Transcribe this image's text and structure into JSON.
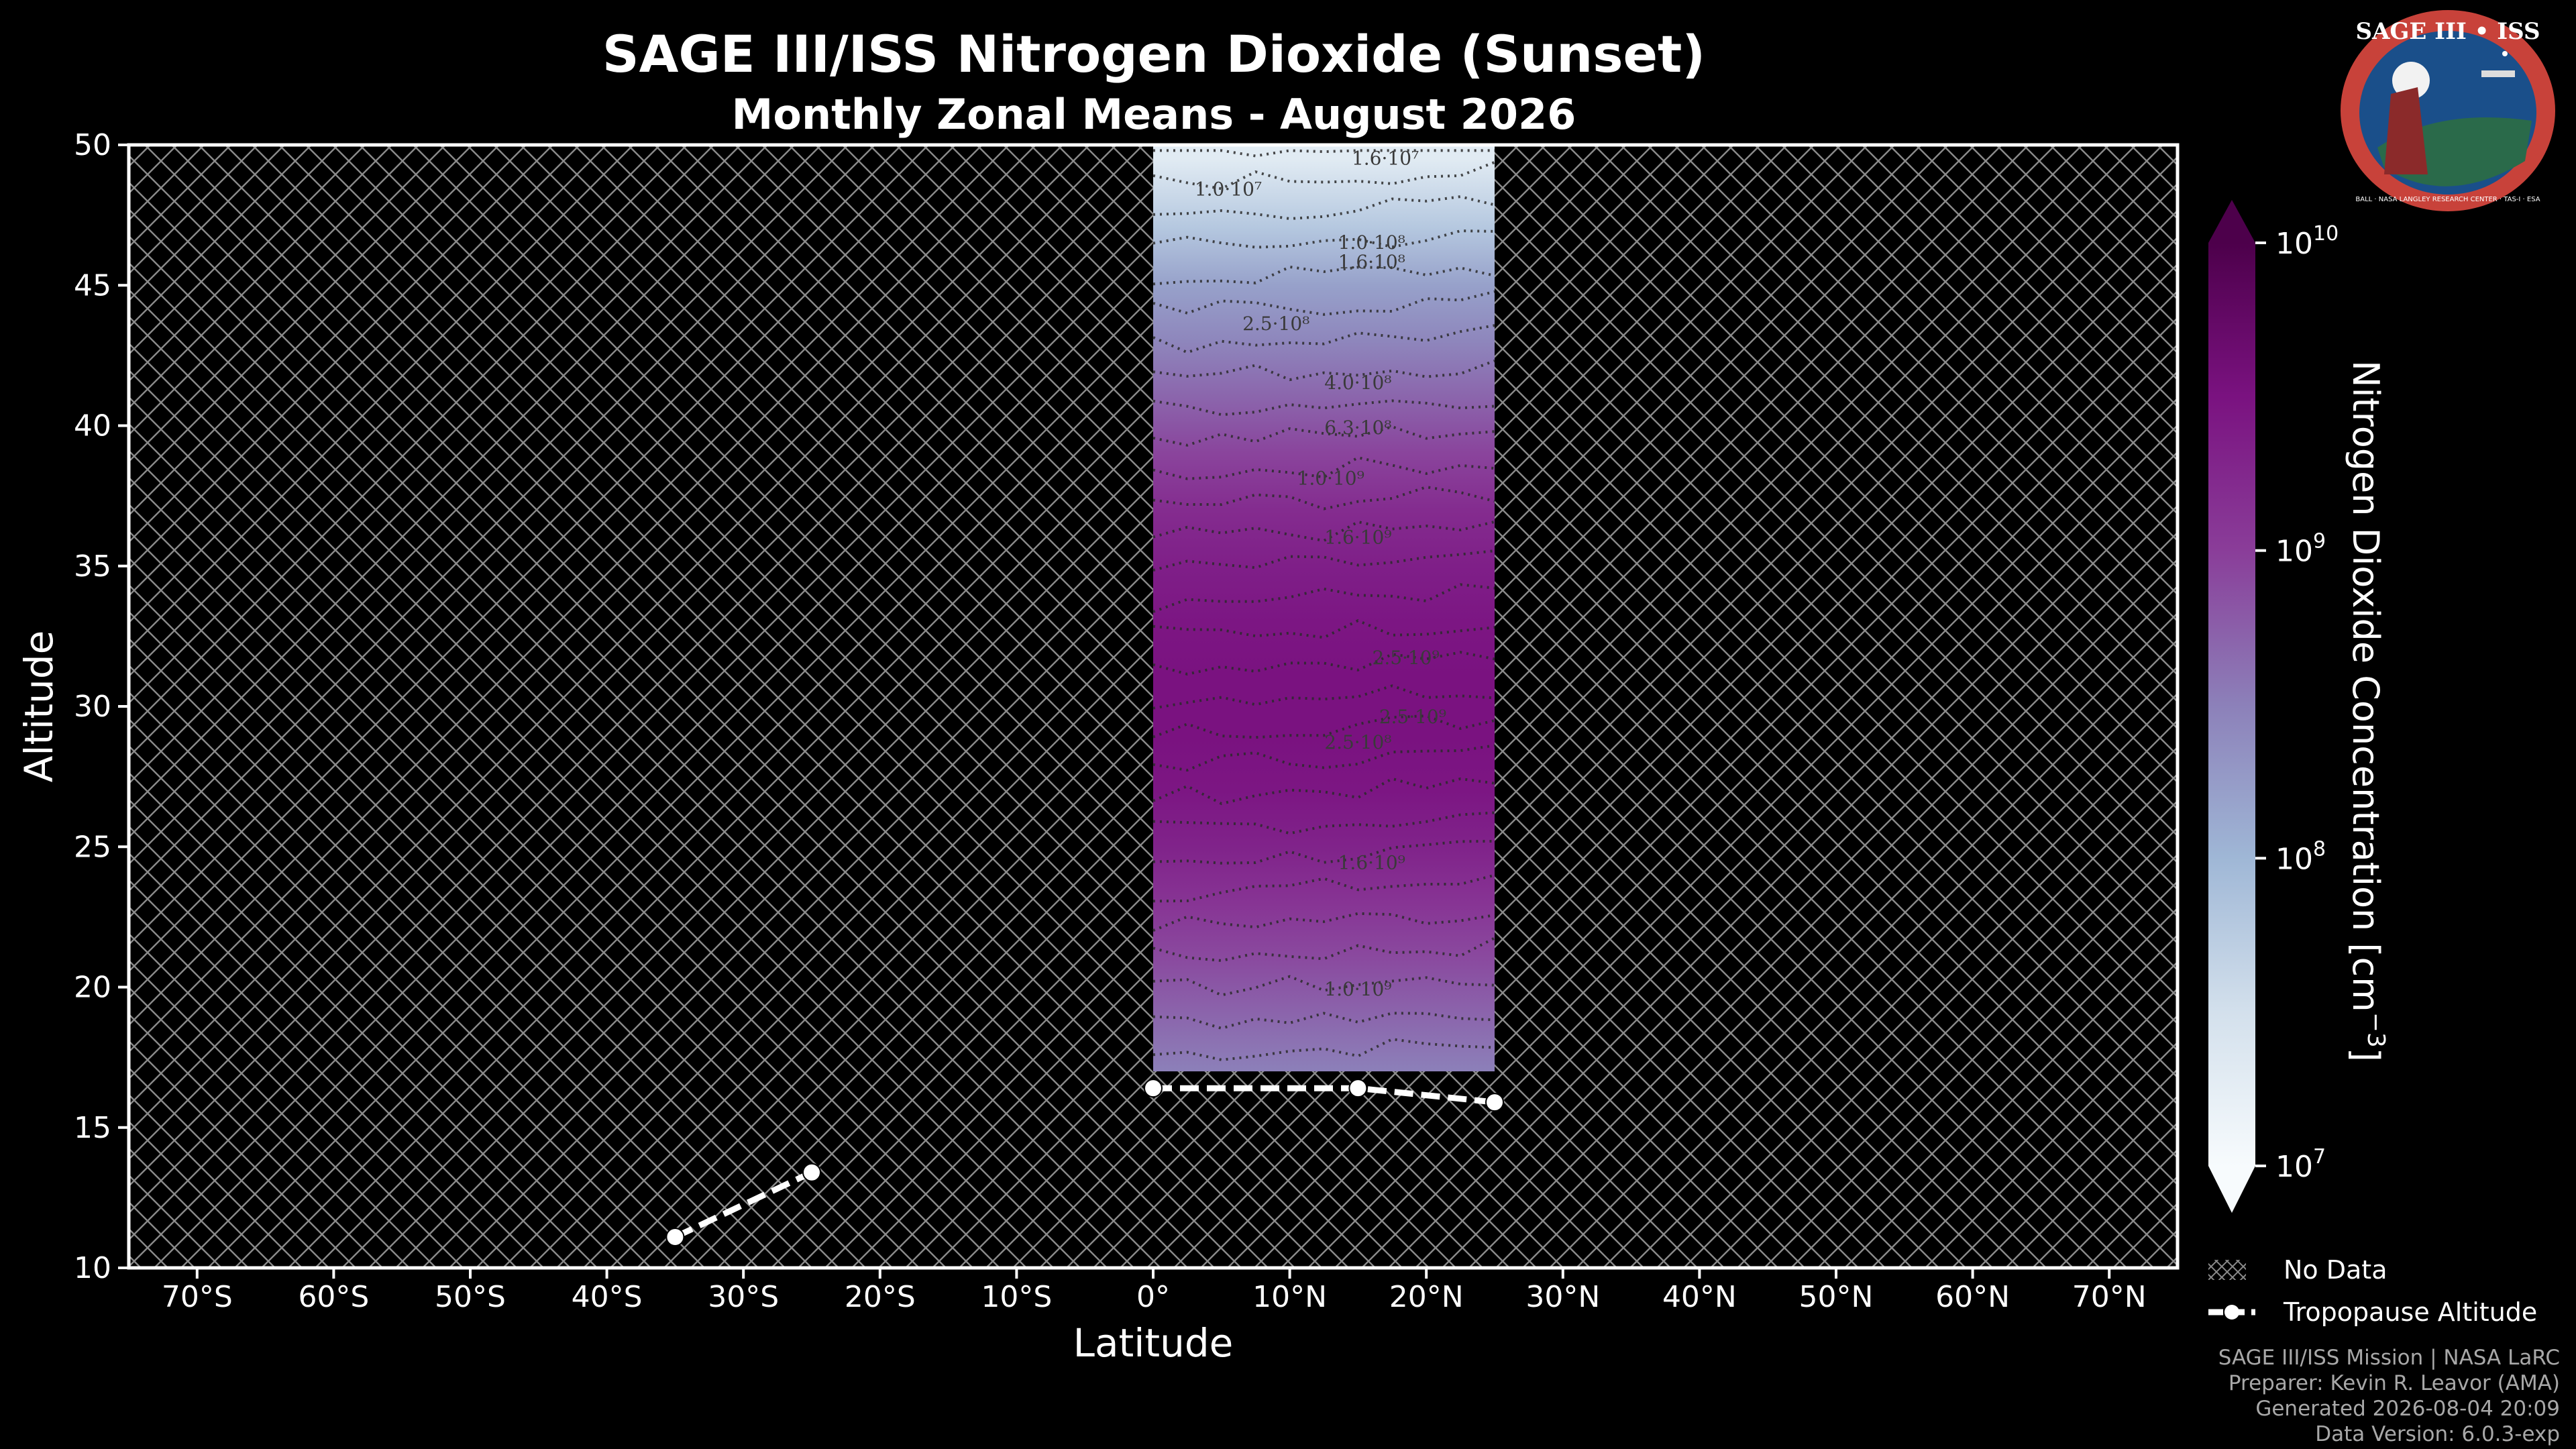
{
  "chart_data": {
    "type": "heatmap",
    "title": "SAGE III/ISS Nitrogen Dioxide (Sunset)",
    "subtitle": "Monthly Zonal Means - August 2026",
    "xlabel": "Latitude",
    "ylabel": "Altitude",
    "xlim": [
      -75,
      75
    ],
    "ylim": [
      10,
      50
    ],
    "x_ticks": [
      -70,
      -60,
      -50,
      -40,
      -30,
      -20,
      -10,
      0,
      10,
      20,
      30,
      40,
      50,
      60,
      70
    ],
    "x_tick_labels": [
      "70°S",
      "60°S",
      "50°S",
      "40°S",
      "30°S",
      "20°S",
      "10°S",
      "0°",
      "10°N",
      "20°N",
      "30°N",
      "40°N",
      "50°N",
      "60°N",
      "70°N"
    ],
    "y_ticks": [
      10,
      15,
      20,
      25,
      30,
      35,
      40,
      45,
      50
    ],
    "y_tick_labels": [
      "10",
      "15",
      "20",
      "25",
      "30",
      "35",
      "40",
      "45",
      "50"
    ],
    "data_region": {
      "lat_range": [
        0,
        25
      ],
      "alt_range": [
        17,
        50
      ]
    },
    "concentration_profile": {
      "altitude": [
        17,
        19,
        21,
        23,
        25,
        27,
        29,
        31,
        33,
        35,
        37,
        39,
        41,
        43,
        45,
        47,
        49.5
      ],
      "log10_value": [
        8.5,
        8.7,
        8.9,
        9.1,
        9.3,
        9.45,
        9.5,
        9.5,
        9.45,
        9.35,
        9.2,
        8.95,
        8.7,
        8.45,
        8.2,
        7.8,
        7.3
      ]
    },
    "colorbar": {
      "label": "Nitrogen Dioxide Concentration [cm",
      "label_sup": "−3",
      "label_end": "]",
      "scale": "log",
      "range": [
        10000000,
        10000000000
      ],
      "ticks": [
        {
          "value": 7,
          "base": "10",
          "exp": "7"
        },
        {
          "value": 8,
          "base": "10",
          "exp": "8"
        },
        {
          "value": 9,
          "base": "10",
          "exp": "9"
        },
        {
          "value": 10,
          "base": "10",
          "exp": "10"
        }
      ],
      "colors": [
        "#f7fbfd",
        "#d3e0ec",
        "#9fb7d6",
        "#8c80b9",
        "#8a3d99",
        "#7a1280",
        "#4d004b"
      ]
    },
    "contour_labels": [
      {
        "lat": 5.5,
        "alt": 48.2,
        "text": "1.0·10⁷"
      },
      {
        "lat": 17,
        "alt": 49.3,
        "text": "1.6·10⁷"
      },
      {
        "lat": 16,
        "alt": 46.3,
        "text": "1.0·10⁸"
      },
      {
        "lat": 16,
        "alt": 45.6,
        "text": "1.6·10⁸"
      },
      {
        "lat": 9,
        "alt": 43.4,
        "text": "2.5·10⁸"
      },
      {
        "lat": 15,
        "alt": 41.3,
        "text": "4.0·10⁸"
      },
      {
        "lat": 15,
        "alt": 39.7,
        "text": "6.3·10⁸"
      },
      {
        "lat": 13,
        "alt": 37.9,
        "text": "1.0·10⁹"
      },
      {
        "lat": 15,
        "alt": 35.8,
        "text": "1.6·10⁹"
      },
      {
        "lat": 18.5,
        "alt": 31.5,
        "text": "2.5·10⁹"
      },
      {
        "lat": 19,
        "alt": 29.4,
        "text": "2.5·10⁹"
      },
      {
        "lat": 15,
        "alt": 28.5,
        "text": "2.5·10⁸"
      },
      {
        "lat": 16,
        "alt": 24.2,
        "text": "1.6·10⁹"
      },
      {
        "lat": 15,
        "alt": 19.7,
        "text": "1.0·10⁹"
      }
    ],
    "series": [
      {
        "name": "Tropopause Altitude",
        "segments": [
          {
            "x": [
              -35,
              -25
            ],
            "y": [
              11.1,
              13.4
            ]
          },
          {
            "x": [
              0,
              15,
              25
            ],
            "y": [
              16.4,
              16.4,
              15.9
            ]
          }
        ]
      }
    ],
    "legend": {
      "position": "bottom-right",
      "entries": [
        {
          "label": "No Data",
          "kind": "hatch"
        },
        {
          "label": "Tropopause Altitude",
          "kind": "line"
        }
      ]
    },
    "grid": false,
    "no_data_pattern": "crosshatch"
  },
  "logo": {
    "text": "SAGE III • ISS",
    "ring_text": "BALL · NASA LANGLEY RESEARCH CENTER · TAS-I · ESA",
    "colors": {
      "ring": "#c8423a",
      "field": "#1a4f8a",
      "ground": "#2a6a4a"
    }
  },
  "credits": {
    "line1": "SAGE III/ISS Mission | NASA LaRC",
    "line2": "Preparer: Kevin R. Leavor (AMA)",
    "line3": "Generated 2026-08-04 20:09",
    "line4": "Data Version: 6.0.3-exp"
  }
}
